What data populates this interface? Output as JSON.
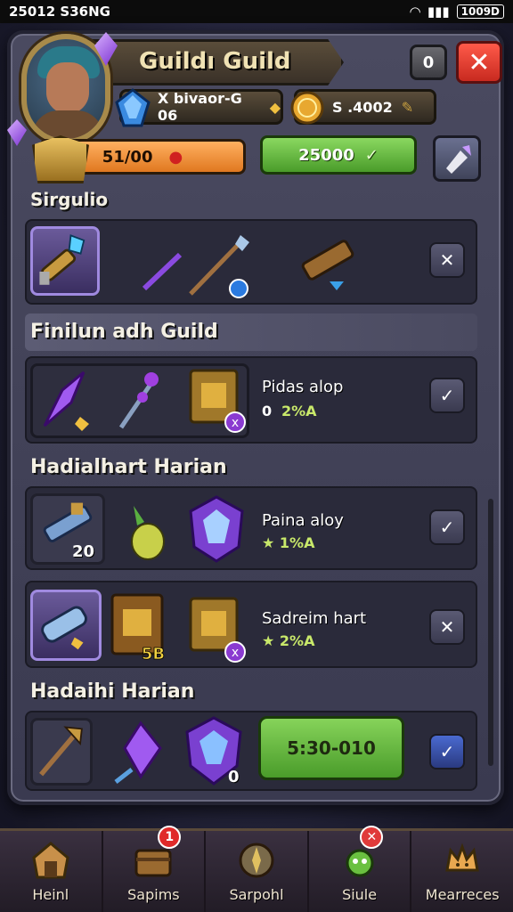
{
  "status_bar": {
    "time": "25012 S36NG",
    "battery": "1009D"
  },
  "header": {
    "title": "Guildı Guild"
  },
  "top_buttons": {
    "info_label": "0",
    "close_label": "✕"
  },
  "resources": {
    "first": "X bivaor-G 06",
    "second": "S .4002"
  },
  "bars": {
    "orange_value": "51/00",
    "green_value": "25000"
  },
  "sections": [
    {
      "title": "Sirgulio"
    },
    {
      "title": "Finilun adh Guild"
    },
    {
      "title": "Hadialhart Harian"
    },
    {
      "title": "Hadaihi Harian"
    }
  ],
  "rows": {
    "row2": {
      "label": "Pidas alop",
      "sub_prefix": "0",
      "sub": "2%A"
    },
    "row3": {
      "label": "Paina aloy",
      "sub": "1%A",
      "badge": "20"
    },
    "row4": {
      "label": "Sadreim hart",
      "sub": "2%A",
      "badge": "5B"
    },
    "row5": {
      "badge": "0",
      "buy_label": "5:30-010"
    }
  },
  "nav": {
    "items": [
      {
        "label": "Heinl"
      },
      {
        "label": "Sapims",
        "badge": "1"
      },
      {
        "label": "Sarpohl"
      },
      {
        "label": "Siule"
      },
      {
        "label": "Mearreces"
      }
    ]
  },
  "colors": {
    "panel": "#3a3a50",
    "accent_green": "#4a9c2a",
    "accent_orange": "#e07820",
    "close_red": "#c82a20",
    "gem_purple": "#7a30d0"
  }
}
